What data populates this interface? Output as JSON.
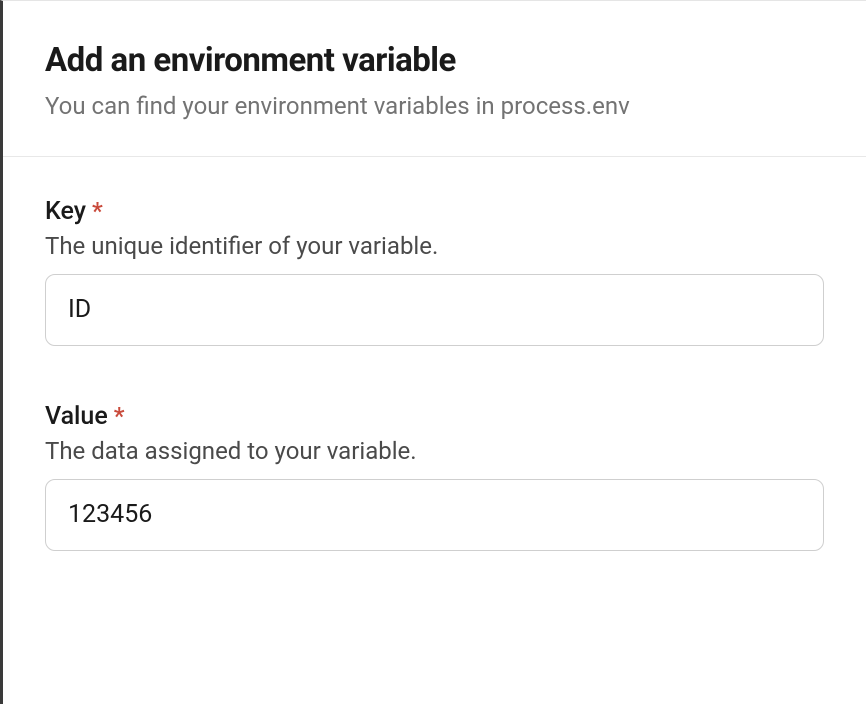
{
  "header": {
    "title": "Add an environment variable",
    "subtitle": "You can find your environment variables in process.env"
  },
  "form": {
    "key": {
      "label": "Key",
      "required_mark": "*",
      "helper": "The unique identifier of your variable.",
      "value": "ID"
    },
    "value": {
      "label": "Value",
      "required_mark": "*",
      "helper": "The data assigned to your variable.",
      "value": "123456"
    }
  }
}
